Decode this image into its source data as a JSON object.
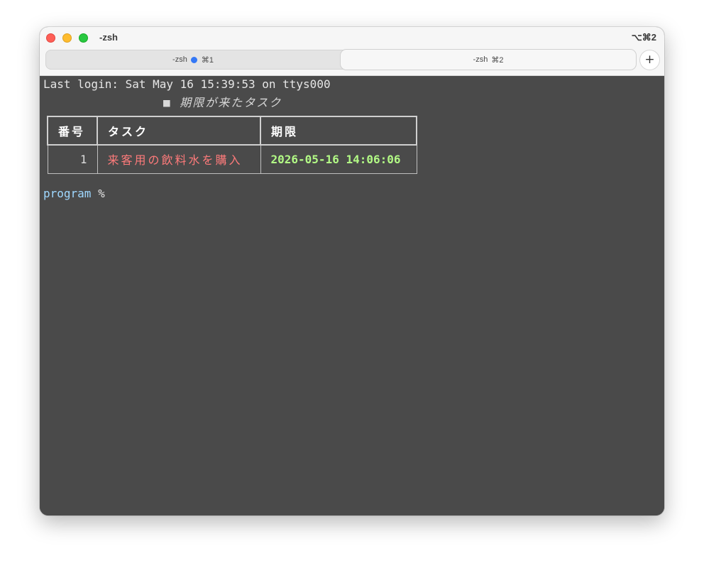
{
  "window": {
    "title": "-zsh",
    "shortcut": "⌥⌘2"
  },
  "tabs": [
    {
      "label": "-zsh",
      "shortcut": "⌘1",
      "has_activity_dot": true
    },
    {
      "label": "-zsh",
      "shortcut": "⌘2",
      "active": true
    }
  ],
  "new_tab_label": "+",
  "terminal": {
    "login_line": "Last login: Sat May 16 15:39:53 on ttys000",
    "table_title": "■ 期限が来たタスク",
    "table": {
      "headers": [
        "番号",
        "タスク",
        "期限"
      ],
      "rows": [
        {
          "num": "1",
          "task": "来客用の飲料水を購入",
          "deadline": "2026-05-16 14:06:06"
        }
      ]
    },
    "prompt_name": "program",
    "prompt_symbol": "%"
  },
  "colors": {
    "terminal_bg": "#4a4a4a",
    "task_text": "#ff7b7b",
    "deadline_text": "#b2fa85",
    "prompt_name": "#9fd8ff",
    "tab_dot": "#3478f6"
  }
}
